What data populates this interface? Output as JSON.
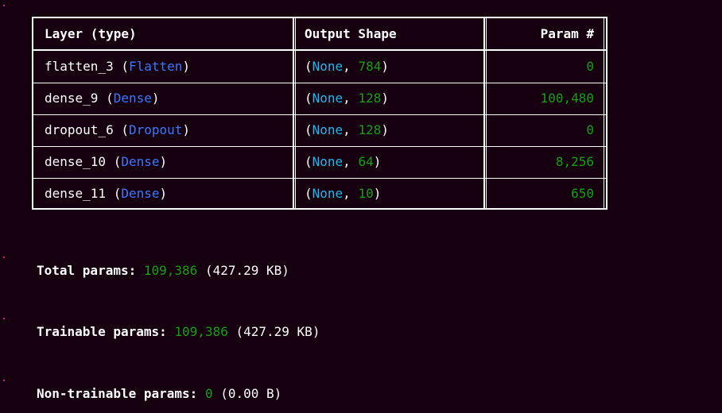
{
  "table": {
    "headers": {
      "layer": "Layer (type)",
      "shape": "Output Shape",
      "param": "Param #"
    },
    "rows": [
      {
        "name": "flatten_3",
        "type": "Flatten",
        "none": "None",
        "dim": "784",
        "params": "0"
      },
      {
        "name": "dense_9",
        "type": "Dense",
        "none": "None",
        "dim": "128",
        "params": "100,480"
      },
      {
        "name": "dropout_6",
        "type": "Dropout",
        "none": "None",
        "dim": "128",
        "params": "0"
      },
      {
        "name": "dense_10",
        "type": "Dense",
        "none": "None",
        "dim": "64",
        "params": "8,256"
      },
      {
        "name": "dense_11",
        "type": "Dense",
        "none": "None",
        "dim": "10",
        "params": "650"
      }
    ]
  },
  "stats": {
    "total": {
      "label": "Total params:",
      "value": "109,386",
      "size": "(427.29 KB)"
    },
    "trainable": {
      "label": "Trainable params:",
      "value": "109,386",
      "size": "(427.29 KB)"
    },
    "non_trainable": {
      "label": "Non-trainable params:",
      "value": "0",
      "size": "(0.00 B)"
    }
  },
  "colors": {
    "background": "#160010",
    "number": "#13a10e",
    "layer_type": "#3b78ff",
    "none_keyword": "#1fb8e8",
    "border": "#ffffff",
    "cell_marker": "#c8188a"
  }
}
